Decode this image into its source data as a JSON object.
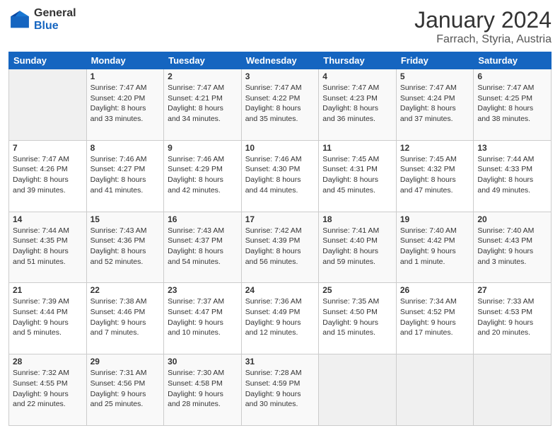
{
  "logo": {
    "general": "General",
    "blue": "Blue"
  },
  "header": {
    "month": "January 2024",
    "location": "Farrach, Styria, Austria"
  },
  "weekdays": [
    "Sunday",
    "Monday",
    "Tuesday",
    "Wednesday",
    "Thursday",
    "Friday",
    "Saturday"
  ],
  "weeks": [
    [
      {
        "day": "",
        "sunrise": "",
        "sunset": "",
        "daylight": ""
      },
      {
        "day": "1",
        "sunrise": "Sunrise: 7:47 AM",
        "sunset": "Sunset: 4:20 PM",
        "daylight": "Daylight: 8 hours",
        "daylight2": "and 33 minutes."
      },
      {
        "day": "2",
        "sunrise": "Sunrise: 7:47 AM",
        "sunset": "Sunset: 4:21 PM",
        "daylight": "Daylight: 8 hours",
        "daylight2": "and 34 minutes."
      },
      {
        "day": "3",
        "sunrise": "Sunrise: 7:47 AM",
        "sunset": "Sunset: 4:22 PM",
        "daylight": "Daylight: 8 hours",
        "daylight2": "and 35 minutes."
      },
      {
        "day": "4",
        "sunrise": "Sunrise: 7:47 AM",
        "sunset": "Sunset: 4:23 PM",
        "daylight": "Daylight: 8 hours",
        "daylight2": "and 36 minutes."
      },
      {
        "day": "5",
        "sunrise": "Sunrise: 7:47 AM",
        "sunset": "Sunset: 4:24 PM",
        "daylight": "Daylight: 8 hours",
        "daylight2": "and 37 minutes."
      },
      {
        "day": "6",
        "sunrise": "Sunrise: 7:47 AM",
        "sunset": "Sunset: 4:25 PM",
        "daylight": "Daylight: 8 hours",
        "daylight2": "and 38 minutes."
      }
    ],
    [
      {
        "day": "7",
        "sunrise": "Sunrise: 7:47 AM",
        "sunset": "Sunset: 4:26 PM",
        "daylight": "Daylight: 8 hours",
        "daylight2": "and 39 minutes."
      },
      {
        "day": "8",
        "sunrise": "Sunrise: 7:46 AM",
        "sunset": "Sunset: 4:27 PM",
        "daylight": "Daylight: 8 hours",
        "daylight2": "and 41 minutes."
      },
      {
        "day": "9",
        "sunrise": "Sunrise: 7:46 AM",
        "sunset": "Sunset: 4:29 PM",
        "daylight": "Daylight: 8 hours",
        "daylight2": "and 42 minutes."
      },
      {
        "day": "10",
        "sunrise": "Sunrise: 7:46 AM",
        "sunset": "Sunset: 4:30 PM",
        "daylight": "Daylight: 8 hours",
        "daylight2": "and 44 minutes."
      },
      {
        "day": "11",
        "sunrise": "Sunrise: 7:45 AM",
        "sunset": "Sunset: 4:31 PM",
        "daylight": "Daylight: 8 hours",
        "daylight2": "and 45 minutes."
      },
      {
        "day": "12",
        "sunrise": "Sunrise: 7:45 AM",
        "sunset": "Sunset: 4:32 PM",
        "daylight": "Daylight: 8 hours",
        "daylight2": "and 47 minutes."
      },
      {
        "day": "13",
        "sunrise": "Sunrise: 7:44 AM",
        "sunset": "Sunset: 4:33 PM",
        "daylight": "Daylight: 8 hours",
        "daylight2": "and 49 minutes."
      }
    ],
    [
      {
        "day": "14",
        "sunrise": "Sunrise: 7:44 AM",
        "sunset": "Sunset: 4:35 PM",
        "daylight": "Daylight: 8 hours",
        "daylight2": "and 51 minutes."
      },
      {
        "day": "15",
        "sunrise": "Sunrise: 7:43 AM",
        "sunset": "Sunset: 4:36 PM",
        "daylight": "Daylight: 8 hours",
        "daylight2": "and 52 minutes."
      },
      {
        "day": "16",
        "sunrise": "Sunrise: 7:43 AM",
        "sunset": "Sunset: 4:37 PM",
        "daylight": "Daylight: 8 hours",
        "daylight2": "and 54 minutes."
      },
      {
        "day": "17",
        "sunrise": "Sunrise: 7:42 AM",
        "sunset": "Sunset: 4:39 PM",
        "daylight": "Daylight: 8 hours",
        "daylight2": "and 56 minutes."
      },
      {
        "day": "18",
        "sunrise": "Sunrise: 7:41 AM",
        "sunset": "Sunset: 4:40 PM",
        "daylight": "Daylight: 8 hours",
        "daylight2": "and 59 minutes."
      },
      {
        "day": "19",
        "sunrise": "Sunrise: 7:40 AM",
        "sunset": "Sunset: 4:42 PM",
        "daylight": "Daylight: 9 hours",
        "daylight2": "and 1 minute."
      },
      {
        "day": "20",
        "sunrise": "Sunrise: 7:40 AM",
        "sunset": "Sunset: 4:43 PM",
        "daylight": "Daylight: 9 hours",
        "daylight2": "and 3 minutes."
      }
    ],
    [
      {
        "day": "21",
        "sunrise": "Sunrise: 7:39 AM",
        "sunset": "Sunset: 4:44 PM",
        "daylight": "Daylight: 9 hours",
        "daylight2": "and 5 minutes."
      },
      {
        "day": "22",
        "sunrise": "Sunrise: 7:38 AM",
        "sunset": "Sunset: 4:46 PM",
        "daylight": "Daylight: 9 hours",
        "daylight2": "and 7 minutes."
      },
      {
        "day": "23",
        "sunrise": "Sunrise: 7:37 AM",
        "sunset": "Sunset: 4:47 PM",
        "daylight": "Daylight: 9 hours",
        "daylight2": "and 10 minutes."
      },
      {
        "day": "24",
        "sunrise": "Sunrise: 7:36 AM",
        "sunset": "Sunset: 4:49 PM",
        "daylight": "Daylight: 9 hours",
        "daylight2": "and 12 minutes."
      },
      {
        "day": "25",
        "sunrise": "Sunrise: 7:35 AM",
        "sunset": "Sunset: 4:50 PM",
        "daylight": "Daylight: 9 hours",
        "daylight2": "and 15 minutes."
      },
      {
        "day": "26",
        "sunrise": "Sunrise: 7:34 AM",
        "sunset": "Sunset: 4:52 PM",
        "daylight": "Daylight: 9 hours",
        "daylight2": "and 17 minutes."
      },
      {
        "day": "27",
        "sunrise": "Sunrise: 7:33 AM",
        "sunset": "Sunset: 4:53 PM",
        "daylight": "Daylight: 9 hours",
        "daylight2": "and 20 minutes."
      }
    ],
    [
      {
        "day": "28",
        "sunrise": "Sunrise: 7:32 AM",
        "sunset": "Sunset: 4:55 PM",
        "daylight": "Daylight: 9 hours",
        "daylight2": "and 22 minutes."
      },
      {
        "day": "29",
        "sunrise": "Sunrise: 7:31 AM",
        "sunset": "Sunset: 4:56 PM",
        "daylight": "Daylight: 9 hours",
        "daylight2": "and 25 minutes."
      },
      {
        "day": "30",
        "sunrise": "Sunrise: 7:30 AM",
        "sunset": "Sunset: 4:58 PM",
        "daylight": "Daylight: 9 hours",
        "daylight2": "and 28 minutes."
      },
      {
        "day": "31",
        "sunrise": "Sunrise: 7:28 AM",
        "sunset": "Sunset: 4:59 PM",
        "daylight": "Daylight: 9 hours",
        "daylight2": "and 30 minutes."
      },
      {
        "day": "",
        "sunrise": "",
        "sunset": "",
        "daylight": ""
      },
      {
        "day": "",
        "sunrise": "",
        "sunset": "",
        "daylight": ""
      },
      {
        "day": "",
        "sunrise": "",
        "sunset": "",
        "daylight": ""
      }
    ]
  ]
}
